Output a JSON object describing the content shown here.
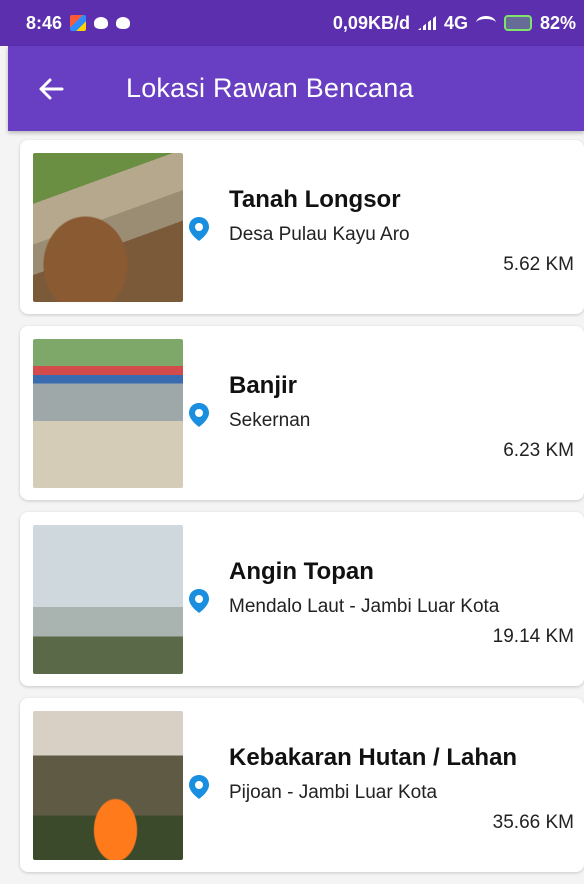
{
  "status_bar": {
    "time": "8:46",
    "network_speed": "0,09KB/d",
    "network_type": "4G",
    "battery": "82%"
  },
  "app_bar": {
    "title": "Lokasi Rawan Bencana",
    "back_icon": "arrow-left-icon"
  },
  "items": [
    {
      "title": "Tanah Longsor",
      "location": "Desa Pulau Kayu Aro",
      "distance": "5.62 KM",
      "image": "landslide-photo"
    },
    {
      "title": "Banjir",
      "location": "Sekernan",
      "distance": "6.23 KM",
      "image": "flood-photo"
    },
    {
      "title": "Angin Topan",
      "location": "Mendalo Laut - Jambi Luar Kota",
      "distance": "19.14 KM",
      "image": "storm-photo"
    },
    {
      "title": "Kebakaran Hutan / Lahan",
      "location": "Pijoan - Jambi Luar Kota",
      "distance": "35.66 KM",
      "image": "forest-fire-photo"
    }
  ],
  "colors": {
    "status_bar": "#5b2fae",
    "app_bar": "#683ec2",
    "pin": "#1a8fe0"
  }
}
